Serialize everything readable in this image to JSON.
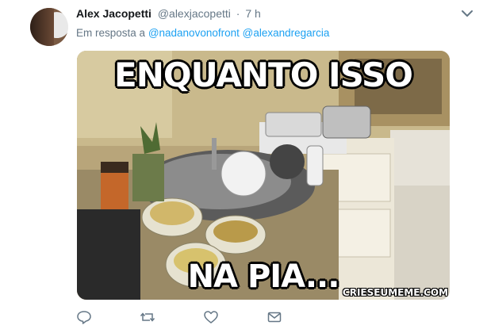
{
  "tweet": {
    "author": {
      "display_name": "Alex Jacopetti",
      "handle": "@alexjacopetti",
      "separator": "·",
      "time": "7 h"
    },
    "reply": {
      "prefix": "Em resposta a",
      "mentions": [
        "@nadanovonofront",
        "@alexandregarcia"
      ]
    },
    "media": {
      "top_text": "ENQUANTO ISSO",
      "bottom_text": "NA PIA...",
      "watermark": "CRIESEUMEME.COM"
    },
    "actions": [
      {
        "name": "reply",
        "icon": "reply-icon"
      },
      {
        "name": "retweet",
        "icon": "retweet-icon"
      },
      {
        "name": "like",
        "icon": "heart-icon"
      },
      {
        "name": "message",
        "icon": "envelope-icon"
      }
    ],
    "more_icon": "chevron-down-icon"
  },
  "colors": {
    "link": "#1da1f2",
    "secondary_text": "#657786",
    "primary_text": "#14171a"
  }
}
